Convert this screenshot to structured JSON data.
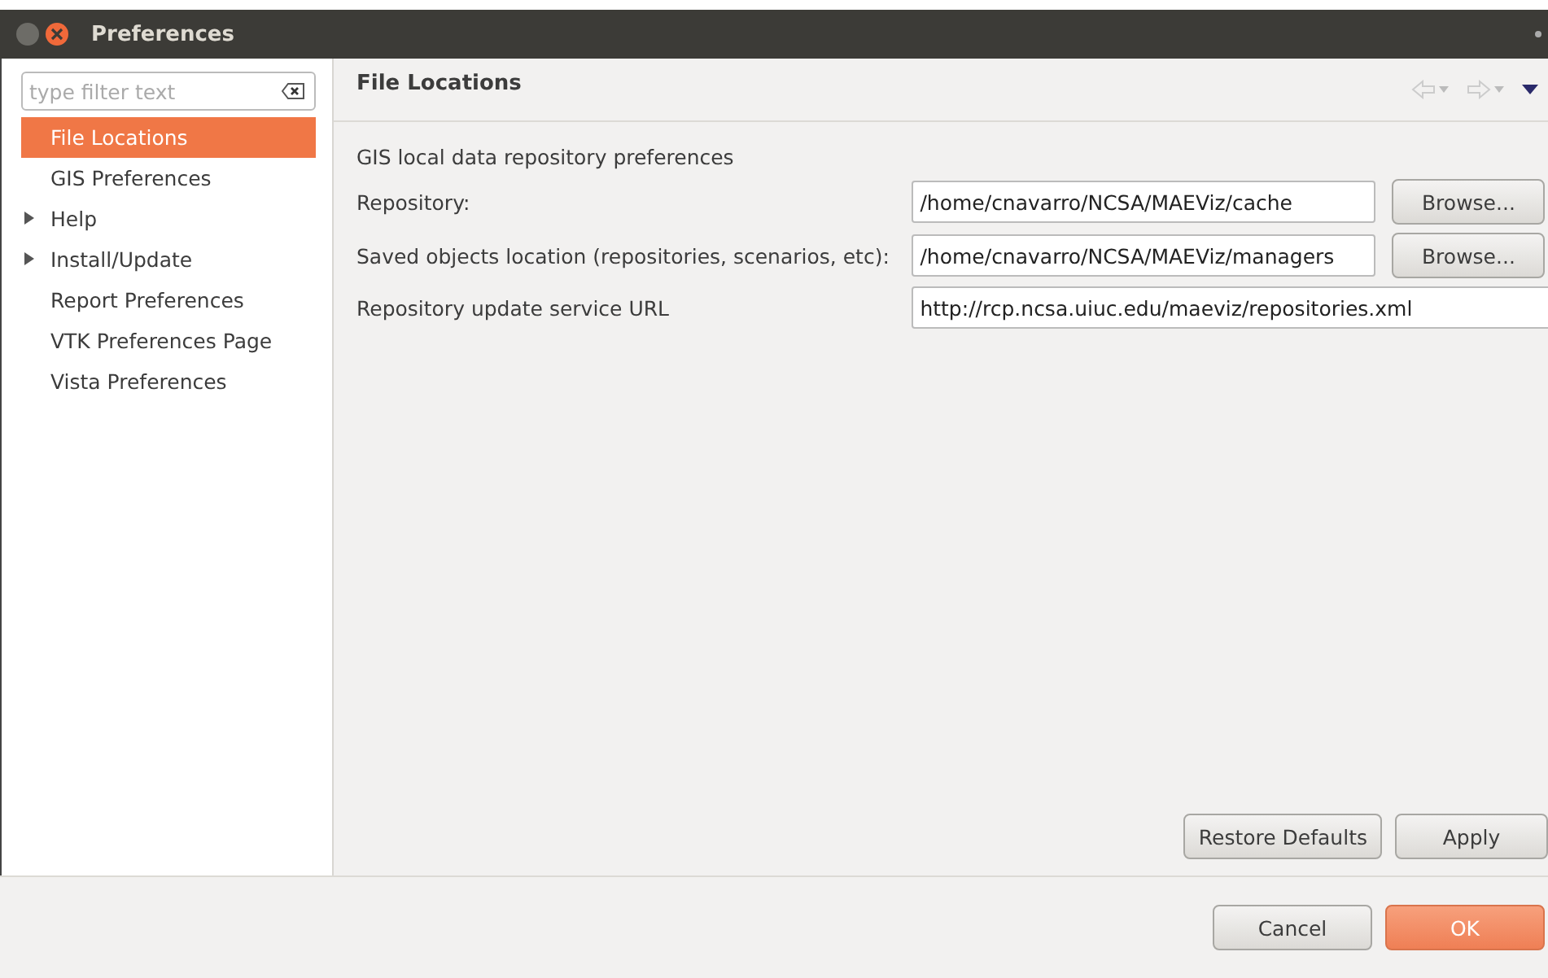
{
  "window": {
    "title": "Preferences"
  },
  "filter": {
    "placeholder": "type filter text"
  },
  "tree": [
    {
      "label": "File Locations",
      "selected": true
    },
    {
      "label": "GIS Preferences",
      "selected": false
    },
    {
      "label": "Help",
      "selected": false,
      "expanded": false
    },
    {
      "label": "Install/Update",
      "selected": false,
      "expanded": false
    },
    {
      "label": "Report Preferences",
      "selected": false
    },
    {
      "label": "VTK Preferences Page",
      "selected": false
    },
    {
      "label": "Vista Preferences",
      "selected": false
    }
  ],
  "page": {
    "title": "File Locations",
    "description": "GIS local data repository preferences",
    "fields": [
      {
        "label": "Repository:",
        "value": "/home/cnavarro/NCSA/MAEViz/cache",
        "button": "Browse..."
      },
      {
        "label": "Saved objects location (repositories, scenarios, etc):",
        "value": "/home/cnavarro/NCSA/MAEViz/managers",
        "button": "Browse..."
      },
      {
        "label": "Repository update service URL",
        "value": "http://rcp.ncsa.uiuc.edu/maeviz/repositories.xml"
      }
    ],
    "buttons": [
      "Restore Defaults",
      "Apply"
    ]
  },
  "dialog_buttons": [
    {
      "label": "Cancel",
      "kind": "normal"
    },
    {
      "label": "OK",
      "kind": "default"
    }
  ]
}
